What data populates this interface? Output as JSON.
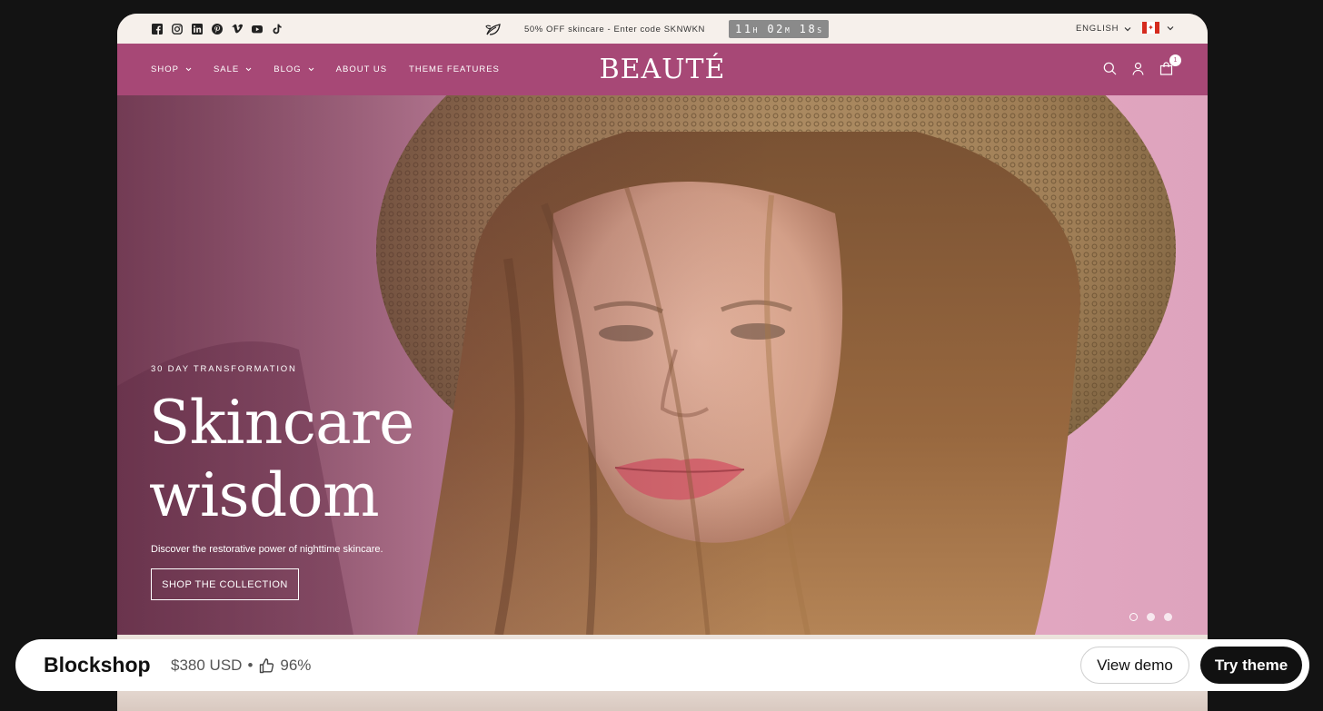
{
  "announcement": {
    "social_icons": [
      "facebook-icon",
      "instagram-icon",
      "linkedin-icon",
      "pinterest-icon",
      "vimeo-icon",
      "youtube-icon",
      "tiktok-icon"
    ],
    "promo_text": "50% OFF skincare - Enter code SKNWKN",
    "countdown": {
      "hours": "11",
      "hours_unit": "H",
      "minutes": "02",
      "minutes_unit": "M",
      "seconds": "18",
      "seconds_unit": "S"
    },
    "language": "ENGLISH",
    "country_icon": "canada-flag-icon"
  },
  "header": {
    "nav": [
      {
        "label": "SHOP",
        "has_dropdown": true
      },
      {
        "label": "SALE",
        "has_dropdown": true
      },
      {
        "label": "BLOG",
        "has_dropdown": true
      },
      {
        "label": "ABOUT US",
        "has_dropdown": false
      },
      {
        "label": "THEME FEATURES",
        "has_dropdown": false
      }
    ],
    "logo": "BEAUTÉ",
    "cart_count": "1",
    "accent_color": "#a74876"
  },
  "hero": {
    "eyebrow": "30 DAY TRANSFORMATION",
    "headline_line1": "Skincare",
    "headline_line2": "wisdom",
    "subtext": "Discover the restorative power of nighttime skincare.",
    "cta": "SHOP THE COLLECTION",
    "slide_count": 3,
    "active_slide": 1
  },
  "bottom_bar": {
    "theme_name": "Blockshop",
    "price": "$380 USD",
    "separator": "•",
    "rating": "96%",
    "view_demo": "View demo",
    "try_theme": "Try theme"
  }
}
